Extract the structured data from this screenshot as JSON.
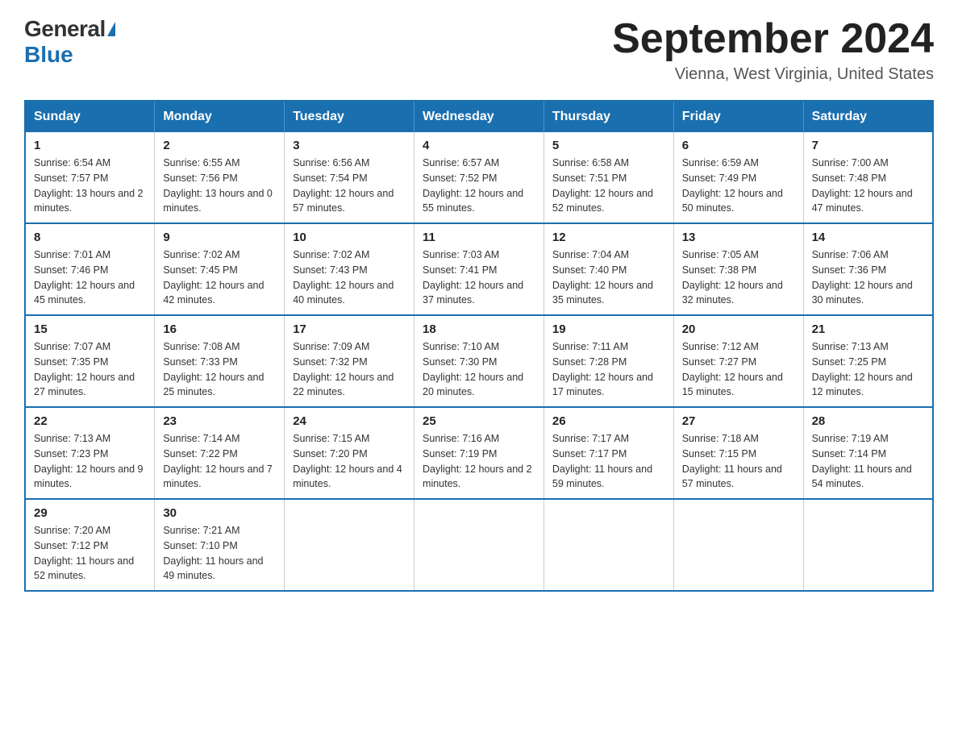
{
  "header": {
    "logo_general": "General",
    "logo_blue": "Blue",
    "title": "September 2024",
    "subtitle": "Vienna, West Virginia, United States"
  },
  "days_of_week": [
    "Sunday",
    "Monday",
    "Tuesday",
    "Wednesday",
    "Thursday",
    "Friday",
    "Saturday"
  ],
  "weeks": [
    [
      {
        "day": "1",
        "sunrise": "6:54 AM",
        "sunset": "7:57 PM",
        "daylight": "13 hours and 2 minutes."
      },
      {
        "day": "2",
        "sunrise": "6:55 AM",
        "sunset": "7:56 PM",
        "daylight": "13 hours and 0 minutes."
      },
      {
        "day": "3",
        "sunrise": "6:56 AM",
        "sunset": "7:54 PM",
        "daylight": "12 hours and 57 minutes."
      },
      {
        "day": "4",
        "sunrise": "6:57 AM",
        "sunset": "7:52 PM",
        "daylight": "12 hours and 55 minutes."
      },
      {
        "day": "5",
        "sunrise": "6:58 AM",
        "sunset": "7:51 PM",
        "daylight": "12 hours and 52 minutes."
      },
      {
        "day": "6",
        "sunrise": "6:59 AM",
        "sunset": "7:49 PM",
        "daylight": "12 hours and 50 minutes."
      },
      {
        "day": "7",
        "sunrise": "7:00 AM",
        "sunset": "7:48 PM",
        "daylight": "12 hours and 47 minutes."
      }
    ],
    [
      {
        "day": "8",
        "sunrise": "7:01 AM",
        "sunset": "7:46 PM",
        "daylight": "12 hours and 45 minutes."
      },
      {
        "day": "9",
        "sunrise": "7:02 AM",
        "sunset": "7:45 PM",
        "daylight": "12 hours and 42 minutes."
      },
      {
        "day": "10",
        "sunrise": "7:02 AM",
        "sunset": "7:43 PM",
        "daylight": "12 hours and 40 minutes."
      },
      {
        "day": "11",
        "sunrise": "7:03 AM",
        "sunset": "7:41 PM",
        "daylight": "12 hours and 37 minutes."
      },
      {
        "day": "12",
        "sunrise": "7:04 AM",
        "sunset": "7:40 PM",
        "daylight": "12 hours and 35 minutes."
      },
      {
        "day": "13",
        "sunrise": "7:05 AM",
        "sunset": "7:38 PM",
        "daylight": "12 hours and 32 minutes."
      },
      {
        "day": "14",
        "sunrise": "7:06 AM",
        "sunset": "7:36 PM",
        "daylight": "12 hours and 30 minutes."
      }
    ],
    [
      {
        "day": "15",
        "sunrise": "7:07 AM",
        "sunset": "7:35 PM",
        "daylight": "12 hours and 27 minutes."
      },
      {
        "day": "16",
        "sunrise": "7:08 AM",
        "sunset": "7:33 PM",
        "daylight": "12 hours and 25 minutes."
      },
      {
        "day": "17",
        "sunrise": "7:09 AM",
        "sunset": "7:32 PM",
        "daylight": "12 hours and 22 minutes."
      },
      {
        "day": "18",
        "sunrise": "7:10 AM",
        "sunset": "7:30 PM",
        "daylight": "12 hours and 20 minutes."
      },
      {
        "day": "19",
        "sunrise": "7:11 AM",
        "sunset": "7:28 PM",
        "daylight": "12 hours and 17 minutes."
      },
      {
        "day": "20",
        "sunrise": "7:12 AM",
        "sunset": "7:27 PM",
        "daylight": "12 hours and 15 minutes."
      },
      {
        "day": "21",
        "sunrise": "7:13 AM",
        "sunset": "7:25 PM",
        "daylight": "12 hours and 12 minutes."
      }
    ],
    [
      {
        "day": "22",
        "sunrise": "7:13 AM",
        "sunset": "7:23 PM",
        "daylight": "12 hours and 9 minutes."
      },
      {
        "day": "23",
        "sunrise": "7:14 AM",
        "sunset": "7:22 PM",
        "daylight": "12 hours and 7 minutes."
      },
      {
        "day": "24",
        "sunrise": "7:15 AM",
        "sunset": "7:20 PM",
        "daylight": "12 hours and 4 minutes."
      },
      {
        "day": "25",
        "sunrise": "7:16 AM",
        "sunset": "7:19 PM",
        "daylight": "12 hours and 2 minutes."
      },
      {
        "day": "26",
        "sunrise": "7:17 AM",
        "sunset": "7:17 PM",
        "daylight": "11 hours and 59 minutes."
      },
      {
        "day": "27",
        "sunrise": "7:18 AM",
        "sunset": "7:15 PM",
        "daylight": "11 hours and 57 minutes."
      },
      {
        "day": "28",
        "sunrise": "7:19 AM",
        "sunset": "7:14 PM",
        "daylight": "11 hours and 54 minutes."
      }
    ],
    [
      {
        "day": "29",
        "sunrise": "7:20 AM",
        "sunset": "7:12 PM",
        "daylight": "11 hours and 52 minutes."
      },
      {
        "day": "30",
        "sunrise": "7:21 AM",
        "sunset": "7:10 PM",
        "daylight": "11 hours and 49 minutes."
      },
      null,
      null,
      null,
      null,
      null
    ]
  ]
}
